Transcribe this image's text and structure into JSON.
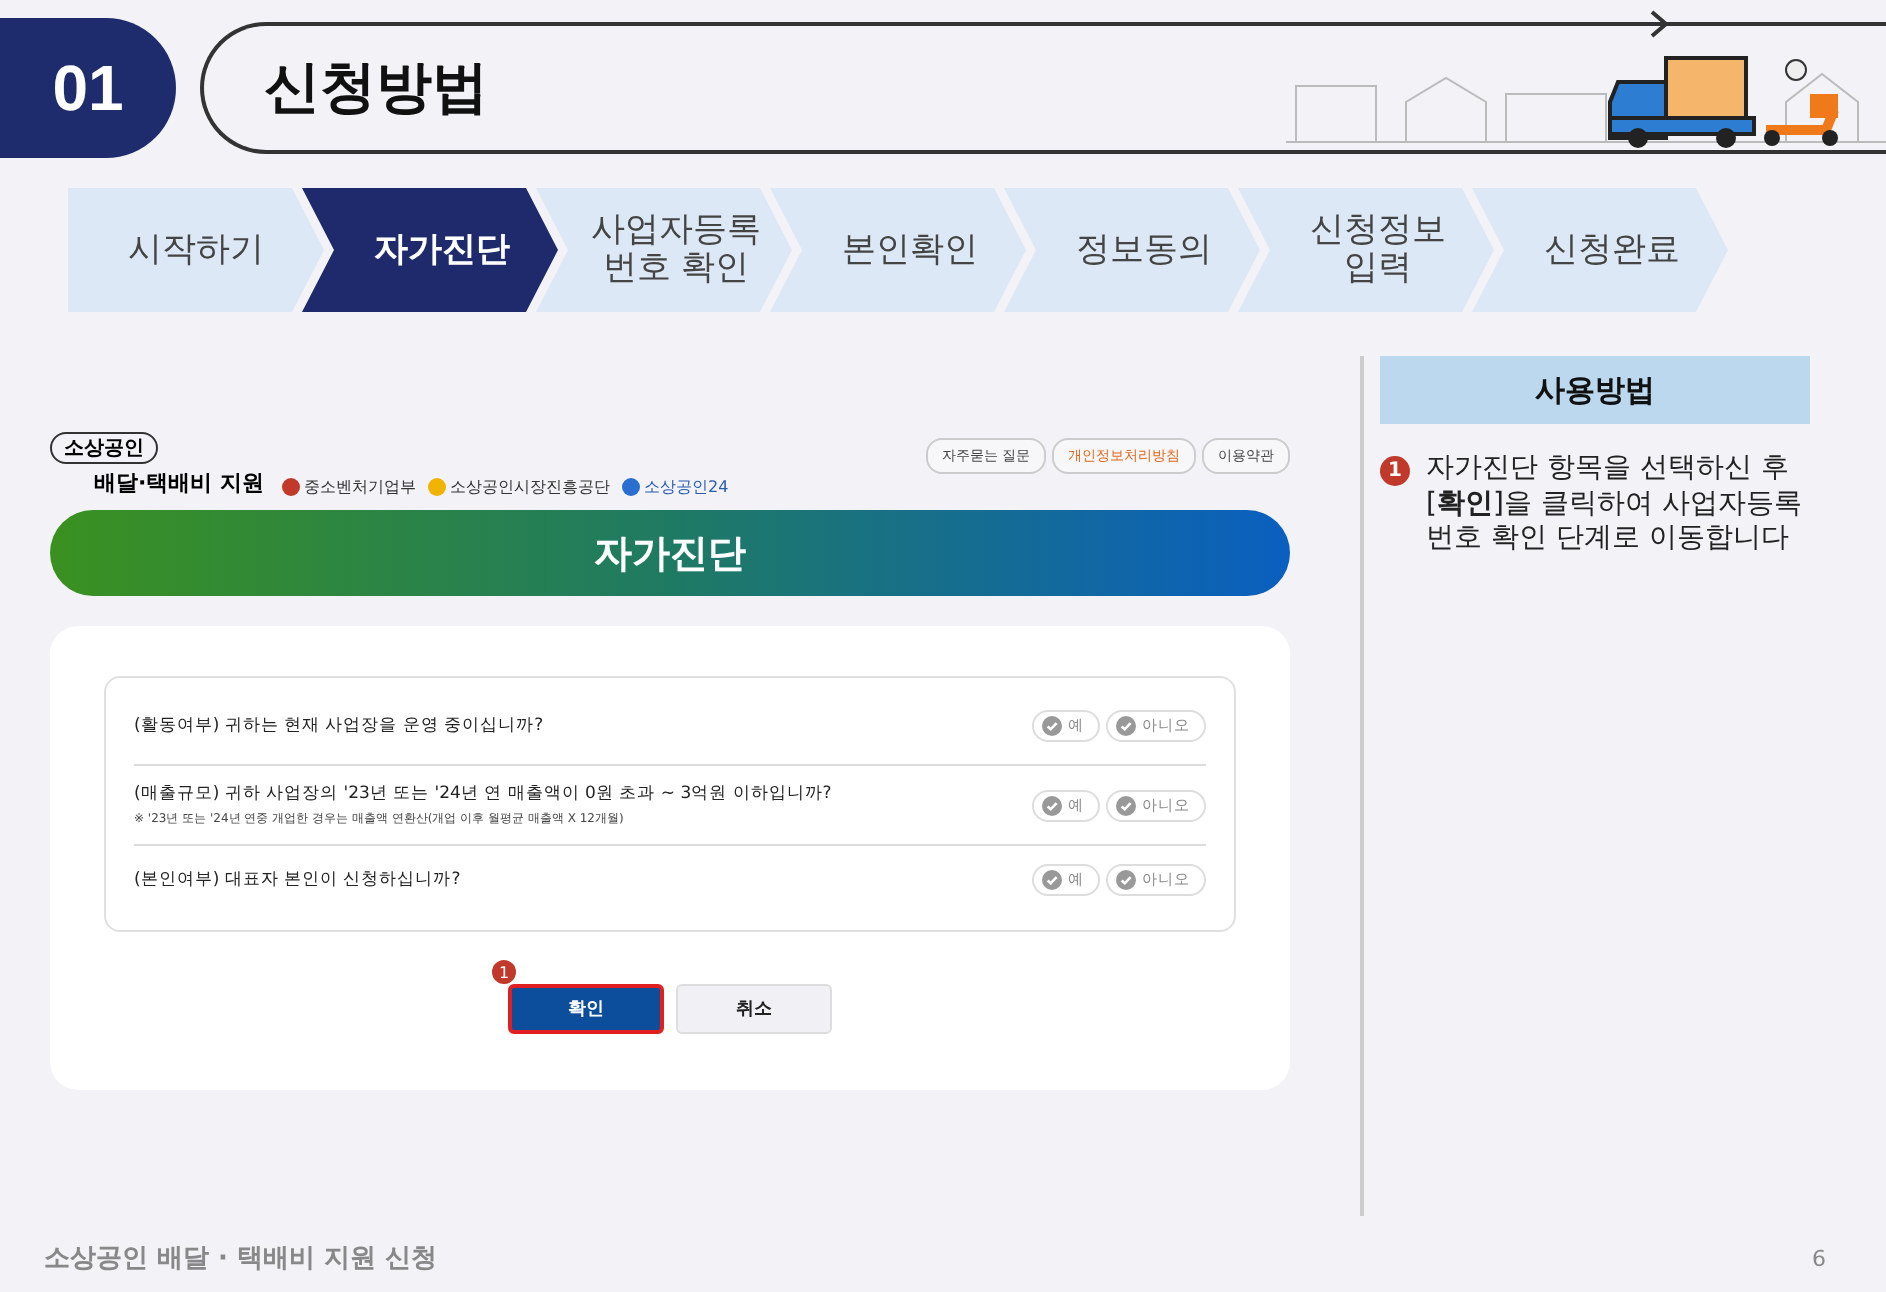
{
  "header": {
    "number": "01",
    "title": "신청방법"
  },
  "steps": [
    {
      "label": "시작하기",
      "selected": false
    },
    {
      "label": "자가진단",
      "selected": true
    },
    {
      "label": "사업자등록\n번호 확인",
      "selected": false
    },
    {
      "label": "본인확인",
      "selected": false
    },
    {
      "label": "정보동의",
      "selected": false
    },
    {
      "label": "신청정보\n입력",
      "selected": false
    },
    {
      "label": "신청완료",
      "selected": false
    }
  ],
  "screen": {
    "logo": {
      "badge": "소상공인",
      "name": "배달·택배비 지원"
    },
    "agencies": [
      "중소벤처기업부",
      "소상공인시장진흥공단",
      "소상공인24"
    ],
    "links": [
      {
        "label": "자주묻는 질문",
        "highlighted": false
      },
      {
        "label": "개인정보처리방침",
        "highlighted": true
      },
      {
        "label": "이용약관",
        "highlighted": false
      }
    ],
    "banner": "자가진단",
    "questions": [
      {
        "text": "(활동여부) 귀하는 현재 사업장을 운영 중이십니까?",
        "options": [
          "예",
          "아니오"
        ]
      },
      {
        "text": "(매출규모) 귀하 사업장의 '23년 또는 '24년 연 매출액이 0원 초과 ~ 3억원 이하입니까?",
        "note": "※ '23년 또는 '24년 연중 개업한 경우는 매출액 연환산(개업 이후 월평균 매출액 X 12개월)",
        "options": [
          "예",
          "아니오"
        ]
      },
      {
        "text": "(본인여부) 대표자 본인이 신청하십니까?",
        "options": [
          "예",
          "아니오"
        ]
      }
    ],
    "buttons": [
      {
        "label": "확인",
        "kind": "primary",
        "marker": "1"
      },
      {
        "label": "취소",
        "kind": "secondary"
      }
    ]
  },
  "guide": {
    "title": "사용방법",
    "items": [
      {
        "marker": "1",
        "text": "자가진단 항목을 선택하신 후 [**확인**]을 클릭하여 사업자등록 번호 확인 단계로 이동합니다"
      }
    ]
  },
  "footer": {
    "title": "소상공인 배달 · 택배비 지원 신청",
    "page": "6"
  }
}
